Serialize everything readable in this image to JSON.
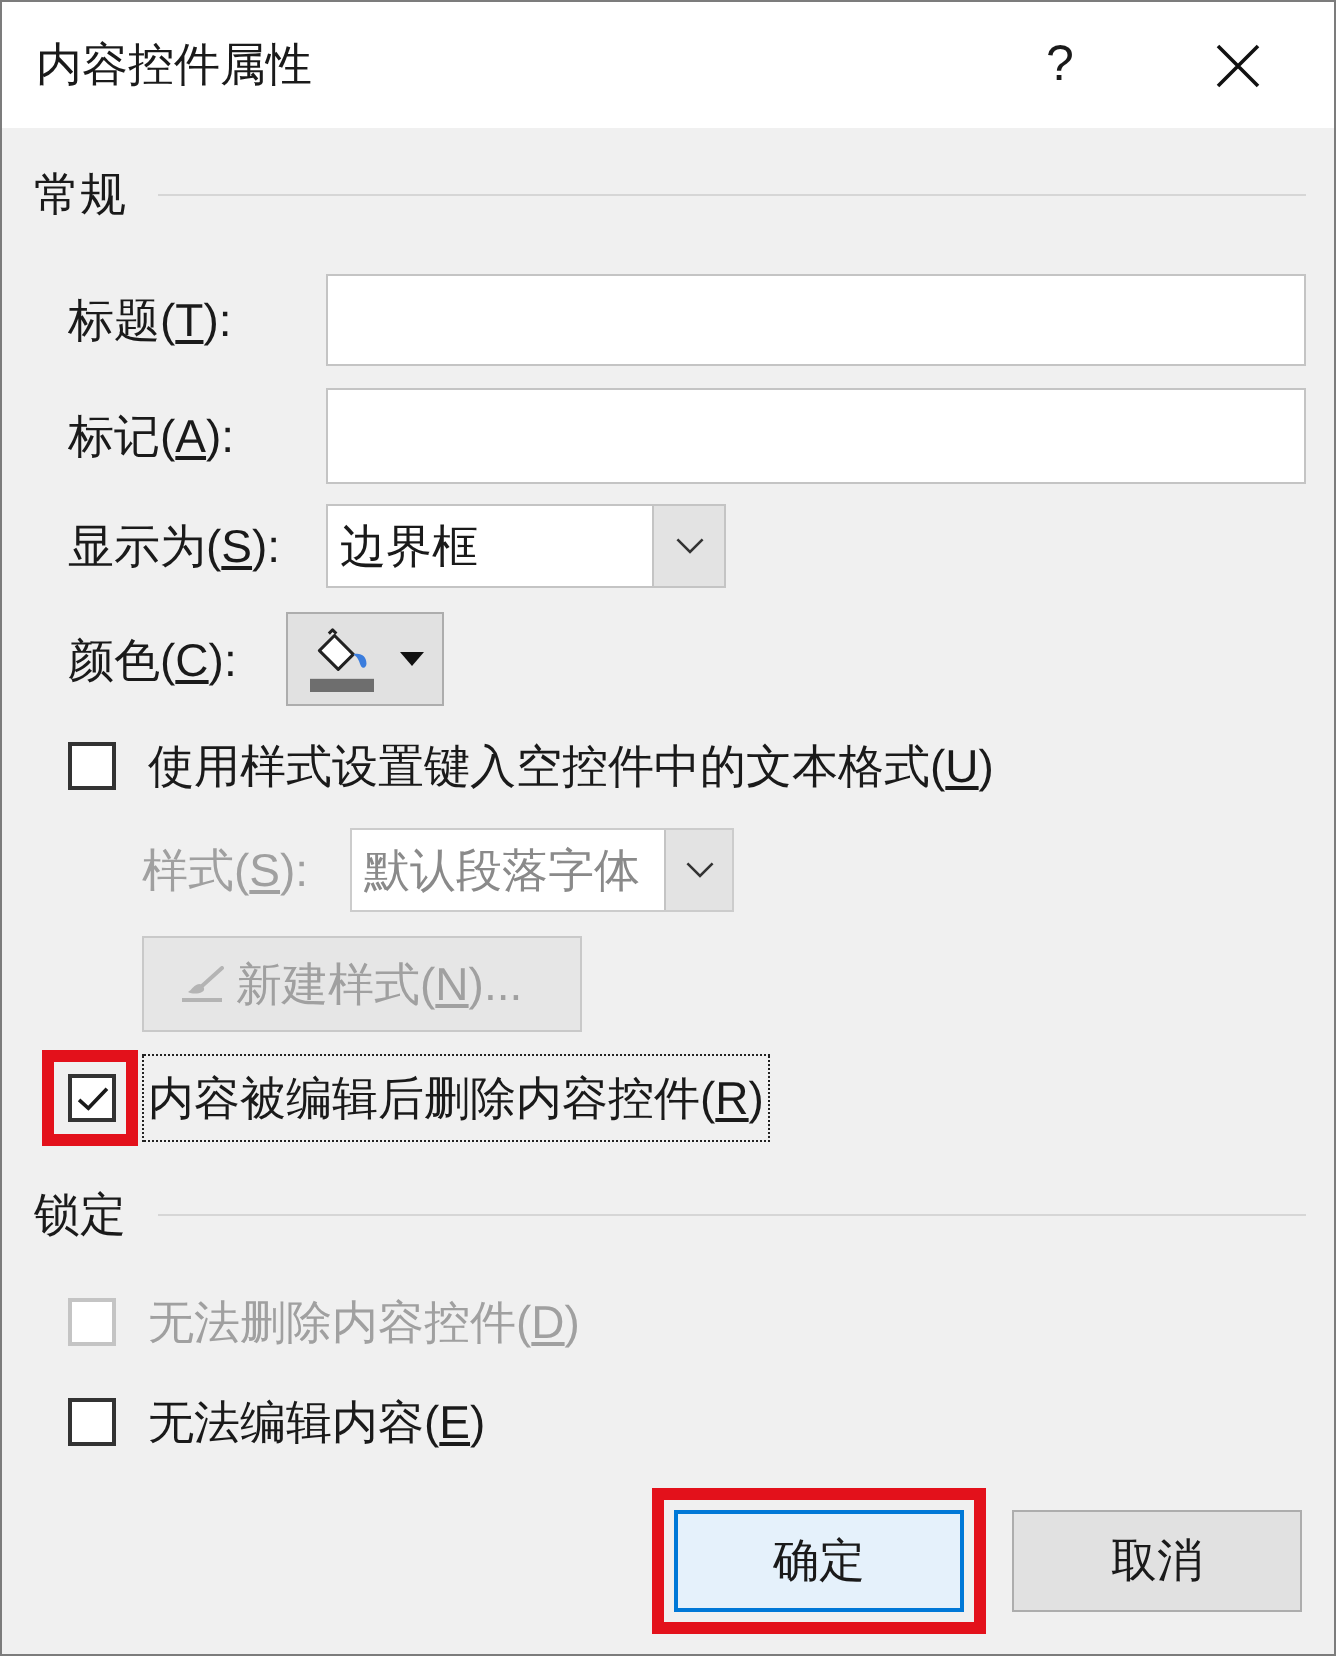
{
  "window": {
    "title": "内容控件属性",
    "help": "?"
  },
  "general": {
    "heading": "常规",
    "title_field": {
      "label_start": "标题(",
      "access_key": "T",
      "label_end": "):"
    },
    "tag_field": {
      "label_start": "标记(",
      "access_key": "A",
      "label_end": "):"
    },
    "show_as": {
      "label_start": "显示为(",
      "access_key": "S",
      "label_end": "):",
      "value": "边界框"
    },
    "color": {
      "label_start": "颜色(",
      "access_key": "C",
      "label_end": "):"
    },
    "use_style": {
      "label_start": "使用样式设置键入空控件中的文本格式(",
      "access_key": "U",
      "label_end": ")",
      "checked": false,
      "disabled": false
    },
    "style": {
      "label_start": "样式(",
      "access_key": "S",
      "label_end": "):",
      "value": "默认段落字体",
      "disabled": true
    },
    "new_style_button": {
      "label_start": "新建样式(",
      "access_key": "N",
      "label_end": ")...",
      "disabled": true
    },
    "remove_after_edit": {
      "label_start": "内容被编辑后删除内容控件(",
      "access_key": "R",
      "label_end": ")",
      "checked": true,
      "disabled": false,
      "focused": true,
      "highlighted": true
    }
  },
  "locking": {
    "heading": "锁定",
    "options": [
      {
        "label_start": "无法删除内容控件(",
        "access_key": "D",
        "label_end": ")",
        "checked": false,
        "disabled": true
      },
      {
        "label_start": "无法编辑内容(",
        "access_key": "E",
        "label_end": ")",
        "checked": false,
        "disabled": false
      }
    ]
  },
  "buttons": [
    {
      "label": "确定",
      "default": true,
      "highlighted": true
    },
    {
      "label": "取消",
      "default": false,
      "highlighted": false
    }
  ]
}
